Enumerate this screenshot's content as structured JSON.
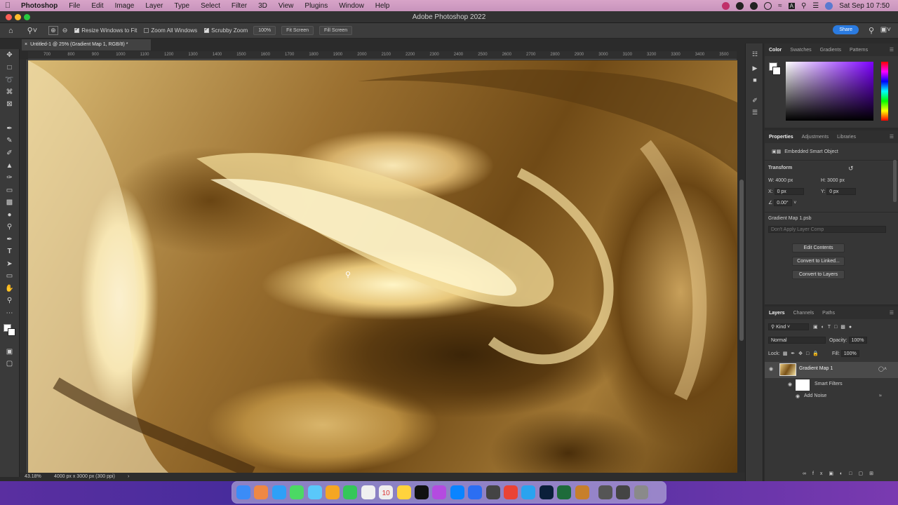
{
  "menubar": {
    "app": "Photoshop",
    "items": [
      "File",
      "Edit",
      "Image",
      "Layer",
      "Type",
      "Select",
      "Filter",
      "3D",
      "View",
      "Plugins",
      "Window",
      "Help"
    ],
    "clock": "Sat Sep 10  7:50",
    "status_icons": [
      "record-icon",
      "creative-cloud-icon",
      "vpn-icon",
      "play-icon",
      "wifi-icon",
      "keyboard-input-icon",
      "search-icon",
      "control-center-icon",
      "siri-icon"
    ]
  },
  "window": {
    "title": "Adobe Photoshop 2022",
    "traffic_colors": [
      "#ff5f57",
      "#febc2e",
      "#28c840"
    ]
  },
  "options_bar": {
    "resize_windows_label": "Resize Windows to Fit",
    "resize_windows_checked": true,
    "zoom_all_label": "Zoom All Windows",
    "zoom_all_checked": false,
    "scrubby_label": "Scrubby Zoom",
    "scrubby_checked": true,
    "zoom_value": "100%",
    "fit_screen_label": "Fit Screen",
    "fill_screen_label": "Fill Screen",
    "share_label": "Share",
    "accent_color": "#2b7be0"
  },
  "document": {
    "tab_title": "Untitled-1 @ 25% (Gradient Map 1, RGB/8) *",
    "ruler_ticks": [
      "700",
      "800",
      "900",
      "1000",
      "1100",
      "1200",
      "1300",
      "1400",
      "1500",
      "1600",
      "1700",
      "1800",
      "1900",
      "2000",
      "2100",
      "2200",
      "2300",
      "2400",
      "2500",
      "2600",
      "2700",
      "2800",
      "2900",
      "3000",
      "3100",
      "3200",
      "3300",
      "3400",
      "3500"
    ],
    "zoom_status": "43.18%",
    "size_status": "4000 px x 3000 px (300 ppi)"
  },
  "tools": [
    "move-icon",
    "marquee-icon",
    "lasso-icon",
    "crop-icon",
    "frame-icon",
    "eyedropper-icon",
    "healing-icon",
    "brush-icon",
    "stamp-icon",
    "history-brush-icon",
    "eraser-icon",
    "gradient-icon",
    "blur-icon",
    "dodge-icon",
    "pen-icon",
    "type-icon",
    "path-select-icon",
    "rectangle-icon",
    "hand-icon",
    "zoom-icon",
    "more-icon"
  ],
  "type_tool_glyph": "T",
  "color_panel": {
    "tabs": [
      "Color",
      "Swatches",
      "Gradients",
      "Patterns"
    ],
    "active": "Color"
  },
  "properties_panel": {
    "tabs": [
      "Properties",
      "Adjustments",
      "Libraries"
    ],
    "active": "Properties",
    "object_type": "Embedded Smart Object",
    "section": "Transform",
    "w_label": "W:",
    "w_value": "4000 px",
    "h_label": "H:",
    "h_value": "3000 px",
    "x_label": "X:",
    "x_value": "0 px",
    "y_label": "Y:",
    "y_value": "0 px",
    "angle_value": "0.00°",
    "file_name": "Gradient Map 1.psb",
    "layer_comp": "Don't Apply Layer Comp",
    "buttons": [
      "Edit Contents",
      "Convert to Linked...",
      "Convert to Layers"
    ]
  },
  "layers_panel": {
    "tabs": [
      "Layers",
      "Channels",
      "Paths"
    ],
    "active": "Layers",
    "filter_kind": "Kind",
    "blend_mode": "Normal",
    "opacity_label": "Opacity:",
    "opacity_value": "100%",
    "lock_label": "Lock:",
    "fill_label": "Fill:",
    "fill_value": "100%",
    "layers": [
      {
        "name": "Gradient Map 1"
      },
      {
        "name": "Smart Filters"
      },
      {
        "name": "Add Noise"
      }
    ]
  },
  "dock_colors": [
    "#3b8cf7",
    "#e84",
    "#2ea0f7",
    "#4bd964",
    "#5ac8fa",
    "#f5a623",
    "#34c759",
    "#f0f0f0",
    "#eee",
    "#ffd33d",
    "#111",
    "#b44be0",
    "#0a84ff",
    "#2b6ef2",
    "#444",
    "#ea4335",
    "#2aa3ef",
    "#0b1f3a",
    "#1e6b3a",
    "#c77f2b",
    "#555",
    "#444",
    "#8a8a8a"
  ],
  "dock_calendar_day": "10"
}
